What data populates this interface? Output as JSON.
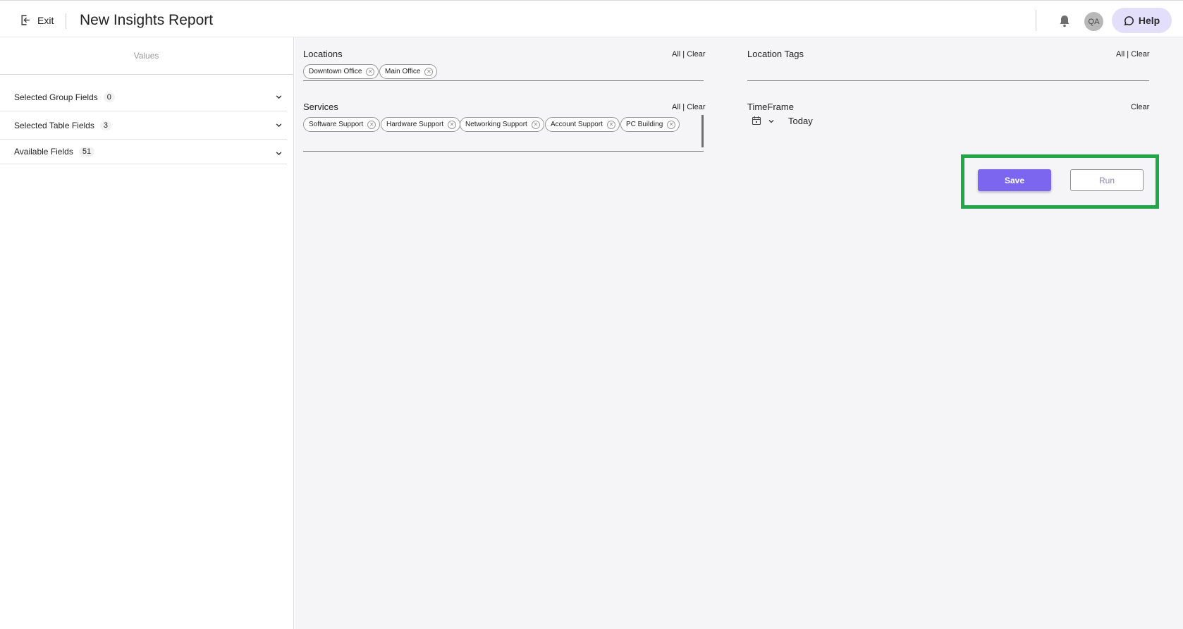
{
  "header": {
    "exit_label": "Exit",
    "title": "New Insights Report",
    "avatar_initials": "QA",
    "help_label": "Help"
  },
  "sidebar": {
    "values_heading": "Values",
    "sections": [
      {
        "label": "Selected Group Fields",
        "count": "0"
      },
      {
        "label": "Selected Table Fields",
        "count": "3"
      },
      {
        "label": "Available Fields",
        "count": "51"
      }
    ]
  },
  "filters": {
    "all_label": "All",
    "divider": "|",
    "clear_label": "Clear",
    "locations": {
      "label": "Locations",
      "chips": [
        "Downtown Office",
        "Main Office"
      ]
    },
    "location_tags": {
      "label": "Location Tags",
      "chips": []
    },
    "services": {
      "label": "Services",
      "chips": [
        "Software Support",
        "Hardware Support",
        "Networking Support",
        "Account Support",
        "PC Building"
      ]
    },
    "timeframe": {
      "label": "TimeFrame",
      "value": "Today"
    }
  },
  "actions": {
    "save_label": "Save",
    "run_label": "Run",
    "highlight_color": "#20a748",
    "primary_color": "#7c66f0"
  }
}
